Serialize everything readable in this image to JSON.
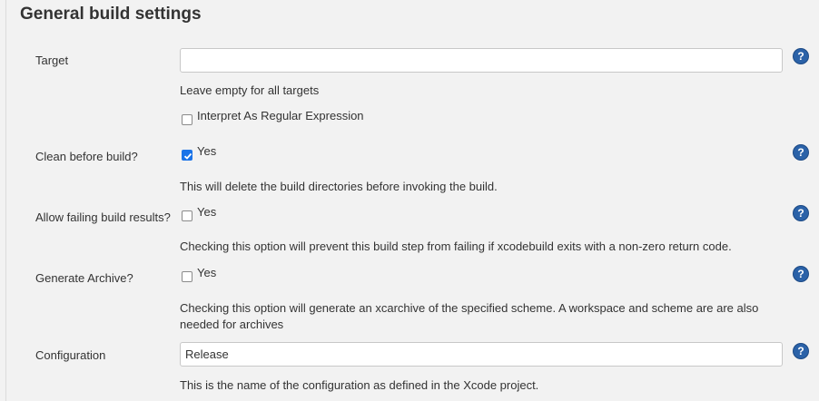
{
  "section_title": "General build settings",
  "help_glyph": "?",
  "target": {
    "label": "Target",
    "value": "",
    "help": "Leave empty for all targets",
    "regex_label": "Interpret As Regular Expression",
    "regex_checked": false
  },
  "clean": {
    "label": "Clean before build?",
    "option": "Yes",
    "checked": true,
    "help": "This will delete the build directories before invoking the build."
  },
  "allow_failing": {
    "label": "Allow failing build results?",
    "option": "Yes",
    "checked": false,
    "help": "Checking this option will prevent this build step from failing if xcodebuild exits with a non-zero return code."
  },
  "archive": {
    "label": "Generate Archive?",
    "option": "Yes",
    "checked": false,
    "help": "Checking this option will generate an xcarchive of the specified scheme. A workspace and scheme are are also needed for archives"
  },
  "configuration": {
    "label": "Configuration",
    "value": "Release",
    "help": "This is the name of the configuration as defined in the Xcode project."
  },
  "colors": {
    "checkbox_checked": "#1a73e8",
    "help_icon": "#2b62a8"
  }
}
